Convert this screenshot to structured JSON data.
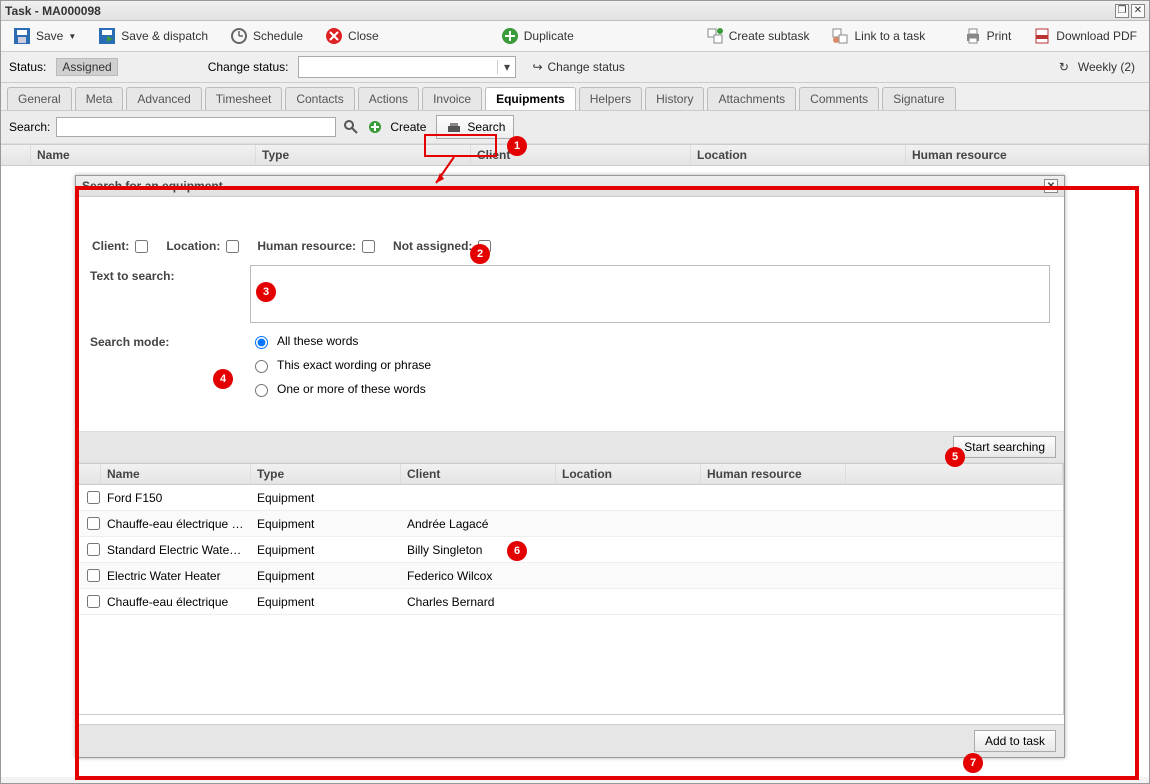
{
  "window": {
    "title": "Task - MA000098"
  },
  "toolbar": {
    "save": "Save",
    "save_dispatch": "Save & dispatch",
    "schedule": "Schedule",
    "close": "Close",
    "duplicate": "Duplicate",
    "create_subtask": "Create subtask",
    "link_task": "Link to a task",
    "print": "Print",
    "download_pdf": "Download PDF"
  },
  "status": {
    "label": "Status:",
    "value": "Assigned",
    "change_label": "Change status:",
    "change_btn": "Change status",
    "weekly": "Weekly (2)"
  },
  "tabs": [
    "General",
    "Meta",
    "Advanced",
    "Timesheet",
    "Contacts",
    "Actions",
    "Invoice",
    "Equipments",
    "Helpers",
    "History",
    "Attachments",
    "Comments",
    "Signature"
  ],
  "active_tab": "Equipments",
  "searchbar": {
    "label": "Search:",
    "create": "Create",
    "search": "Search"
  },
  "grid_headers": [
    "Name",
    "Type",
    "Client",
    "Location",
    "Human resource"
  ],
  "dialog": {
    "title": "Search for an equipment",
    "filters": {
      "client": "Client:",
      "location": "Location:",
      "hr": "Human resource:",
      "notassigned": "Not assigned:"
    },
    "text_label": "Text to search:",
    "mode_label": "Search mode:",
    "modes": [
      "All these words",
      "This exact wording or phrase",
      "One or more of these words"
    ],
    "start": "Start searching",
    "add": "Add to task",
    "cols": [
      "Name",
      "Type",
      "Client",
      "Location",
      "Human resource"
    ],
    "rows": [
      {
        "name": "Ford F150",
        "type": "Equipment",
        "client": "",
        "location": "",
        "hr": ""
      },
      {
        "name": "Chauffe-eau électrique Sta...",
        "type": "Equipment",
        "client": "Andrée Lagacé",
        "location": "",
        "hr": ""
      },
      {
        "name": "Standard Electric Water H...",
        "type": "Equipment",
        "client": "Billy Singleton",
        "location": "",
        "hr": ""
      },
      {
        "name": "Electric Water Heater",
        "type": "Equipment",
        "client": "Federico Wilcox",
        "location": "",
        "hr": ""
      },
      {
        "name": "Chauffe-eau électrique",
        "type": "Equipment",
        "client": "Charles Bernard",
        "location": "",
        "hr": ""
      }
    ]
  },
  "callouts": [
    "1",
    "2",
    "3",
    "4",
    "5",
    "6",
    "7"
  ]
}
